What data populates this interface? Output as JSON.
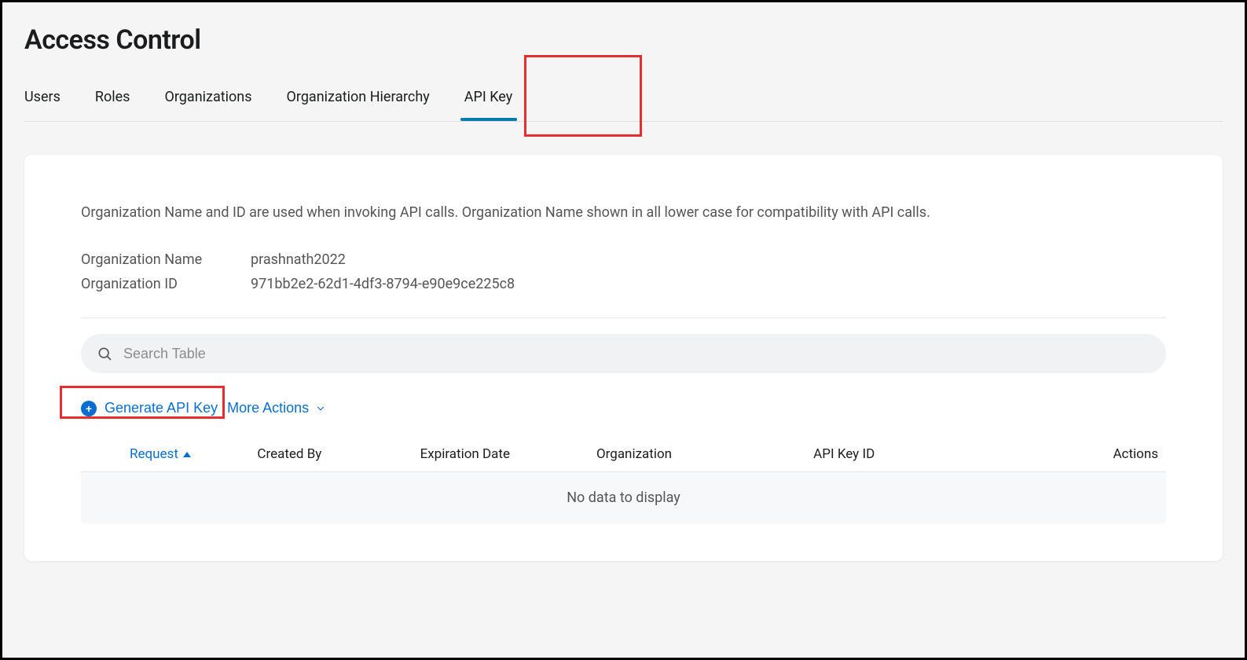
{
  "page": {
    "title": "Access Control"
  },
  "tabs": {
    "items": [
      {
        "label": "Users",
        "active": false
      },
      {
        "label": "Roles",
        "active": false
      },
      {
        "label": "Organizations",
        "active": false
      },
      {
        "label": "Organization Hierarchy",
        "active": false
      },
      {
        "label": "API Key",
        "active": true
      }
    ]
  },
  "panel": {
    "description": "Organization Name and ID are used when invoking API calls. Organization Name shown in all lower case for compatibility with API calls.",
    "org_name_label": "Organization Name",
    "org_name_value": "prashnath2022",
    "org_id_label": "Organization ID",
    "org_id_value": "971bb2e2-62d1-4df3-8794-e90e9ce225c8"
  },
  "search": {
    "placeholder": "Search Table"
  },
  "actions": {
    "generate_label": "Generate API Key",
    "more_label": "More Actions"
  },
  "table": {
    "columns": {
      "request": "Request",
      "created_by": "Created By",
      "expiration": "Expiration Date",
      "organization": "Organization",
      "api_key_id": "API Key ID",
      "actions": "Actions"
    },
    "empty_message": "No data to display"
  }
}
